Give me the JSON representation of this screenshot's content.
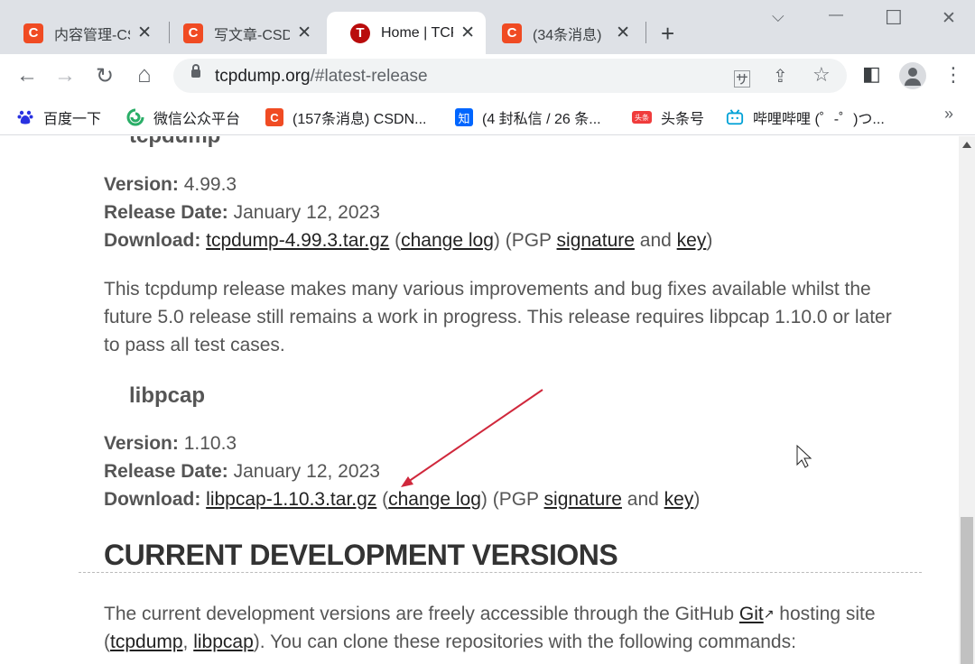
{
  "tabs": [
    {
      "title": "内容管理-CSDN",
      "favicon": "C",
      "active": false
    },
    {
      "title": "写文章-CSDN",
      "favicon": "C",
      "active": false
    },
    {
      "title": "Home | TCPDUMP",
      "favicon": "T",
      "active": true
    },
    {
      "title": "(34条消息)",
      "favicon": "C",
      "active": false
    }
  ],
  "icons": {
    "close": "✕",
    "new_tab": "+",
    "minimize": "—",
    "maximize": "☐",
    "window_close": "✕",
    "tab_search": "⌵",
    "back": "←",
    "forward": "→",
    "reload": "↻",
    "home": "⌂",
    "translate": "🈂",
    "share": "⇪",
    "star": "☆",
    "side_panel": "◧",
    "menu": "⋮",
    "bookmarks_more": "»",
    "external_link": "↗"
  },
  "address_bar": {
    "host": "tcpdump.org",
    "path": "/#latest-release"
  },
  "bookmarks": [
    {
      "label": "百度一下",
      "icon": "baidu-icon"
    },
    {
      "label": "微信公众平台",
      "icon": "wechat-icon"
    },
    {
      "label": "(157条消息) CSDN...",
      "icon": "csdn-icon"
    },
    {
      "label": "(4 封私信 / 26 条...",
      "icon": "zhihu-icon",
      "glyph": "知"
    },
    {
      "label": "头条号",
      "icon": "toutiao-icon",
      "glyph": "头条"
    },
    {
      "label": "哔哩哔哩 (゜-゜)つ...",
      "icon": "bilibili-icon"
    }
  ],
  "page": {
    "tcpdump": {
      "heading": "tcpdump",
      "version_label": "Version:",
      "version": "4.99.3",
      "date_label": "Release Date:",
      "date": "January 12, 2023",
      "download_label": "Download:",
      "tarball": "tcpdump-4.99.3.tar.gz",
      "changelog": "change log",
      "pgp_text": "(PGP",
      "signature": "signature",
      "and": "and",
      "key": "key",
      "description": "This tcpdump release makes many various improvements and bug fixes available whilst the future 5.0 release still remains a work in progress. This release requires libpcap 1.10.0 or later to pass all test cases."
    },
    "libpcap": {
      "heading": "libpcap",
      "version_label": "Version:",
      "version": "1.10.3",
      "date_label": "Release Date:",
      "date": "January 12, 2023",
      "download_label": "Download:",
      "tarball": "libpcap-1.10.3.tar.gz",
      "changelog": "change log",
      "pgp_text": "(PGP",
      "signature": "signature",
      "and": "and",
      "key": "key"
    },
    "dev": {
      "heading": "CURRENT DEVELOPMENT VERSIONS",
      "text_1": "The current development versions are freely accessible through the GitHub",
      "git_link": "Git",
      "text_2": "hosting site (",
      "tcpdump_link": "tcpdump",
      "libpcap_link": "libpcap",
      "text_3": "). You can clone these repositories with the following commands:"
    }
  },
  "colors": {
    "annotation_arrow": "#d0283c",
    "csdn": "#f04b23",
    "tcpdump_favicon": "#b90c0c"
  }
}
